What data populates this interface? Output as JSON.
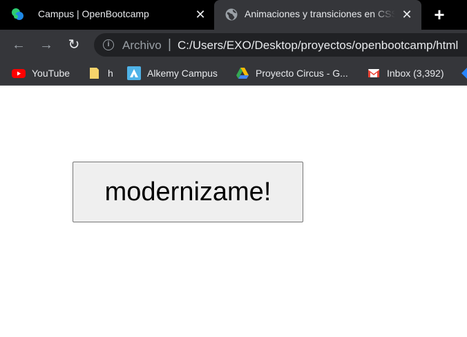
{
  "browser": {
    "tabs": [
      {
        "title": "Campus | OpenBootcamp",
        "icon": "openbootcamp-logo-icon",
        "active": false
      },
      {
        "title": "Animaciones y transiciones en CSS",
        "icon": "globe-icon",
        "active": true
      }
    ],
    "close_glyph": "✕",
    "new_tab_glyph": "+",
    "toolbar": {
      "back_glyph": "←",
      "forward_glyph": "→",
      "reload_glyph": "↻",
      "info_glyph": "i",
      "security_label": "Archivo",
      "separator": "|",
      "url": "C:/Users/EXO/Desktop/proyectos/openbootcamp/html"
    },
    "bookmarks": [
      {
        "label": "YouTube",
        "icon": "youtube-icon"
      },
      {
        "label": "h",
        "icon": "folder-icon"
      },
      {
        "label": "Alkemy Campus",
        "icon": "alkemy-icon"
      },
      {
        "label": "Proyecto Circus - G...",
        "icon": "google-drive-icon"
      },
      {
        "label": "Inbox (3,392)",
        "icon": "gmail-icon"
      }
    ]
  },
  "page": {
    "button_label": "modernizame!"
  },
  "colors": {
    "tabstrip": "#000000",
    "toolbar": "#35363a",
    "omnibox": "#202124",
    "button_bg": "#efefef"
  }
}
